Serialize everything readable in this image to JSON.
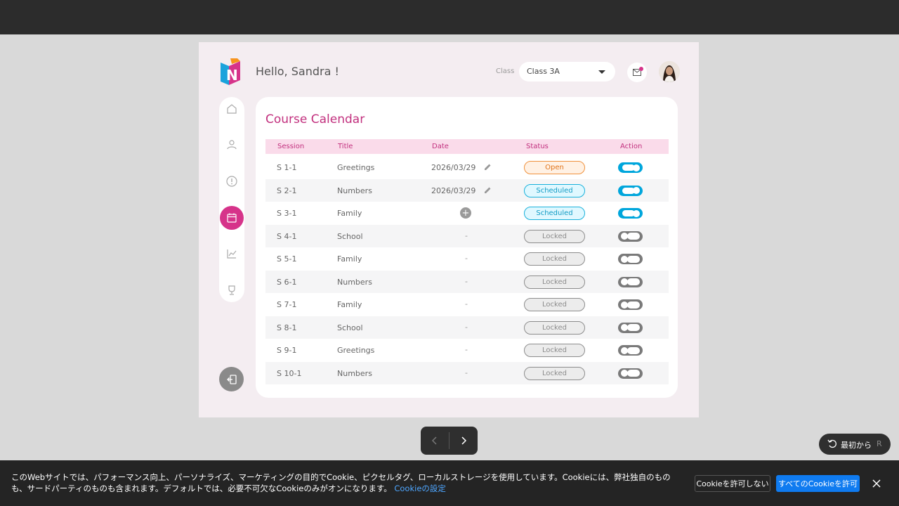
{
  "header": {
    "greeting": "Hello, Sandra !",
    "class_label": "Class",
    "class_value": "Class 3A"
  },
  "sidebar": {
    "items": [
      {
        "name": "home-icon"
      },
      {
        "name": "user-icon"
      },
      {
        "name": "alert-icon"
      },
      {
        "name": "calendar-icon",
        "active": true
      },
      {
        "name": "chart-icon"
      },
      {
        "name": "trophy-icon"
      }
    ]
  },
  "card": {
    "title": "Course Calendar",
    "columns": [
      "Session",
      "Title",
      "Date",
      "Status",
      "Action"
    ],
    "rows": [
      {
        "session": "S 1-1",
        "title": "Greetings",
        "date": "2026/03/29",
        "status": "Open",
        "status_kind": "open",
        "action_on": true
      },
      {
        "session": "S 2-1",
        "title": "Numbers",
        "date": "2026/03/29",
        "status": "Scheduled",
        "status_kind": "scheduled",
        "action_on": true
      },
      {
        "session": "S 3-1",
        "title": "Family",
        "date": "+",
        "status": "Scheduled",
        "status_kind": "scheduled",
        "action_on": true
      },
      {
        "session": "S 4-1",
        "title": "School",
        "date": "-",
        "status": "Locked",
        "status_kind": "locked",
        "action_on": false
      },
      {
        "session": "S 5-1",
        "title": "Family",
        "date": "-",
        "status": "Locked",
        "status_kind": "locked",
        "action_on": false
      },
      {
        "session": "S 6-1",
        "title": "Numbers",
        "date": "-",
        "status": "Locked",
        "status_kind": "locked",
        "action_on": false
      },
      {
        "session": "S 7-1",
        "title": "Family",
        "date": "-",
        "status": "Locked",
        "status_kind": "locked",
        "action_on": false
      },
      {
        "session": "S 8-1",
        "title": "School",
        "date": "-",
        "status": "Locked",
        "status_kind": "locked",
        "action_on": false
      },
      {
        "session": "S 9-1",
        "title": "Greetings",
        "date": "-",
        "status": "Locked",
        "status_kind": "locked",
        "action_on": false
      },
      {
        "session": "S 10-1",
        "title": "Numbers",
        "date": "-",
        "status": "Locked",
        "status_kind": "locked",
        "action_on": false
      }
    ]
  },
  "player": {
    "restart_label": "最初から",
    "restart_key": "R"
  },
  "cookie": {
    "text": "このWebサイトでは、パフォーマンス向上、パーソナライズ、マーケティングの目的でCookie、ピクセルタグ、ローカルストレージを使用しています。Cookieには、弊社独自のものも、サードパーティのものも含まれます。デフォルトでは、必要不可欠なCookieのみがオンになります。",
    "settings_link": "Cookieの設定",
    "deny_label": "Cookieを許可しない",
    "accept_label": "すべてのCookieを許可"
  },
  "colors": {
    "accent": "#d6338a",
    "toggle_on": "#00a6dc",
    "app_bg": "#f4edf1"
  }
}
